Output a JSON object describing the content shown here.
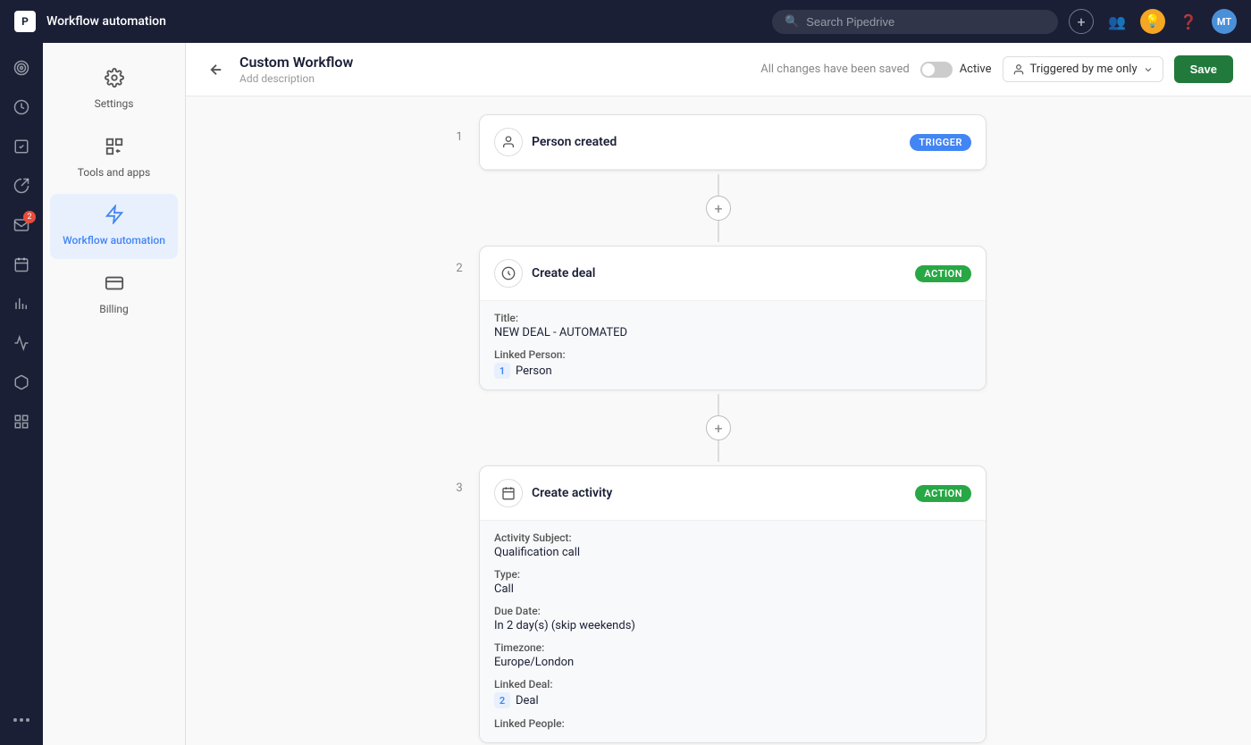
{
  "topbar": {
    "title": "Workflow automation",
    "search_placeholder": "Search Pipedrive",
    "avatar": "MT",
    "plus_label": "+"
  },
  "sidebar": {
    "items": [
      {
        "name": "target-icon",
        "icon": "◎",
        "active": false
      },
      {
        "name": "dollar-icon",
        "icon": "$",
        "active": false
      },
      {
        "name": "check-icon",
        "icon": "✓",
        "active": false
      },
      {
        "name": "megaphone-icon",
        "icon": "📢",
        "active": false
      },
      {
        "name": "mail-icon",
        "icon": "✉",
        "active": false,
        "badge": "2"
      },
      {
        "name": "calendar-icon",
        "icon": "📅",
        "active": false
      },
      {
        "name": "list-icon",
        "icon": "☰",
        "active": false
      },
      {
        "name": "chart-icon",
        "icon": "📊",
        "active": false
      },
      {
        "name": "box-icon",
        "icon": "⬜",
        "active": false
      },
      {
        "name": "grid-icon",
        "icon": "⊞",
        "active": false
      },
      {
        "name": "more-icon",
        "icon": "···",
        "active": false
      }
    ]
  },
  "left_nav": {
    "items": [
      {
        "name": "settings",
        "label": "Settings",
        "icon": "⚙",
        "active": false
      },
      {
        "name": "tools-and-apps",
        "label": "Tools and apps",
        "icon": "⊞",
        "active": false
      },
      {
        "name": "workflow-automation",
        "label": "Workflow automation",
        "icon": "⚡",
        "active": true
      },
      {
        "name": "billing",
        "label": "Billing",
        "icon": "💳",
        "active": false
      }
    ]
  },
  "workflow_header": {
    "back_label": "←",
    "title": "Custom Workflow",
    "description": "Add description",
    "saved_text": "All changes have been saved",
    "active_label": "Active",
    "triggered_by": "Triggered by me only",
    "save_label": "Save"
  },
  "steps": [
    {
      "number": "1",
      "badge": "TRIGGER",
      "badge_type": "trigger",
      "icon": "👤",
      "title": "Person created",
      "has_details": false
    },
    {
      "number": "2",
      "badge": "ACTION",
      "badge_type": "action",
      "icon": "💲",
      "title": "Create deal",
      "has_details": true,
      "details": [
        {
          "label": "Title:",
          "value": "NEW DEAL - AUTOMATED",
          "tag": null
        },
        {
          "label": "Linked Person:",
          "value": "Person",
          "tag": "1"
        }
      ]
    },
    {
      "number": "3",
      "badge": "ACTION",
      "badge_type": "action",
      "icon": "📅",
      "title": "Create activity",
      "has_details": true,
      "details": [
        {
          "label": "Activity Subject:",
          "value": "Qualification call",
          "tag": null
        },
        {
          "label": "Type:",
          "value": "Call",
          "tag": null
        },
        {
          "label": "Due Date:",
          "value": "In 2 day(s) (skip weekends)",
          "tag": null
        },
        {
          "label": "Timezone:",
          "value": "Europe/London",
          "tag": null
        },
        {
          "label": "Linked Deal:",
          "value": "Deal",
          "tag": "2"
        },
        {
          "label": "Linked People:",
          "value": "",
          "tag": null
        }
      ]
    }
  ],
  "connectors": [
    {
      "id": "c1"
    },
    {
      "id": "c2"
    }
  ]
}
